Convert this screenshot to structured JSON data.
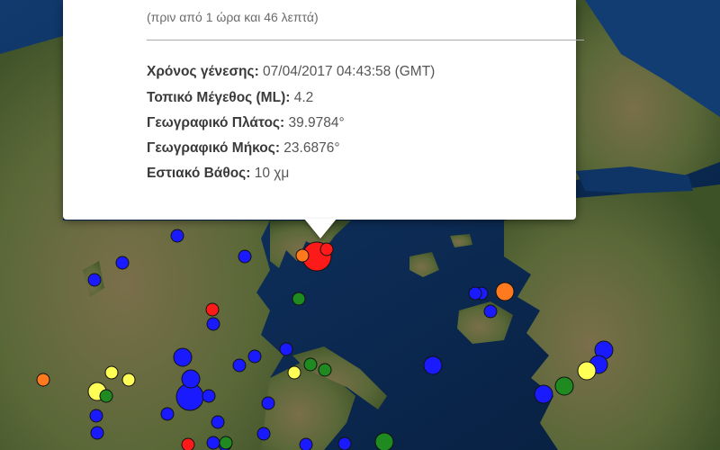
{
  "popup": {
    "time_ago": "(πριν από 1 ώρα και 46 λεπτά)",
    "fields": [
      {
        "label": "Χρόνος γένεσης:",
        "value": " 07/04/2017  04:43:58 (GMT)"
      },
      {
        "label": "Τοπικό Μέγεθος (ML):",
        "value": " 4.2"
      },
      {
        "label": "Γεωγραφικό Πλάτος:",
        "value": " 39.9784°"
      },
      {
        "label": "Γεωγραφικό Μήκος:",
        "value": " 23.6876°"
      },
      {
        "label": "Εστιακό Βάθος:",
        "value": " 10 χμ"
      }
    ]
  },
  "colors": {
    "sea": "#0b2a52",
    "land": "#5d6a3c",
    "mountain": "#8a7d5e",
    "marker_red": "#ff1a1a",
    "marker_orange": "#ff7a1f",
    "marker_yellow": "#ffff55",
    "marker_green": "#1f8a1f",
    "marker_blue": "#1a1aff"
  },
  "markers": [
    {
      "color": "red",
      "size": "large"
    },
    {
      "color": "red",
      "size": "small"
    },
    {
      "color": "orange",
      "size": "small"
    },
    {
      "color": "green",
      "size": "small"
    },
    {
      "color": "red",
      "size": "small"
    },
    {
      "color": "blue",
      "size": "small"
    },
    {
      "color": "blue",
      "size": "small"
    },
    {
      "color": "blue",
      "size": "small"
    },
    {
      "color": "blue",
      "size": "small"
    },
    {
      "color": "blue",
      "size": "small"
    },
    {
      "color": "blue",
      "size": "small"
    },
    {
      "color": "blue",
      "size": "small"
    },
    {
      "color": "blue",
      "size": "small"
    },
    {
      "color": "blue",
      "size": "medium"
    },
    {
      "color": "blue",
      "size": "large"
    },
    {
      "color": "blue",
      "size": "small"
    },
    {
      "color": "blue",
      "size": "small"
    },
    {
      "color": "blue",
      "size": "small"
    },
    {
      "color": "blue",
      "size": "small"
    },
    {
      "color": "blue",
      "size": "small"
    },
    {
      "color": "blue",
      "size": "small"
    },
    {
      "color": "blue",
      "size": "small"
    },
    {
      "color": "blue",
      "size": "small"
    },
    {
      "color": "yellow",
      "size": "small"
    },
    {
      "color": "yellow",
      "size": "small"
    },
    {
      "color": "yellow",
      "size": "small"
    },
    {
      "color": "yellow",
      "size": "medium"
    },
    {
      "color": "green",
      "size": "small"
    },
    {
      "color": "green",
      "size": "small"
    },
    {
      "color": "green",
      "size": "small"
    },
    {
      "color": "orange",
      "size": "small"
    },
    {
      "color": "blue",
      "size": "medium"
    },
    {
      "color": "blue",
      "size": "small"
    },
    {
      "color": "blue",
      "size": "small"
    },
    {
      "color": "blue",
      "size": "small"
    },
    {
      "color": "orange",
      "size": "medium"
    },
    {
      "color": "blue",
      "size": "medium"
    },
    {
      "color": "blue",
      "size": "medium"
    },
    {
      "color": "blue",
      "size": "medium"
    },
    {
      "color": "yellow",
      "size": "medium"
    },
    {
      "color": "green",
      "size": "medium"
    },
    {
      "color": "blue",
      "size": "medium"
    },
    {
      "color": "blue",
      "size": "small"
    },
    {
      "color": "green",
      "size": "medium"
    },
    {
      "color": "blue",
      "size": "small"
    },
    {
      "color": "blue",
      "size": "small"
    },
    {
      "color": "green",
      "size": "small"
    },
    {
      "color": "red",
      "size": "small"
    }
  ]
}
